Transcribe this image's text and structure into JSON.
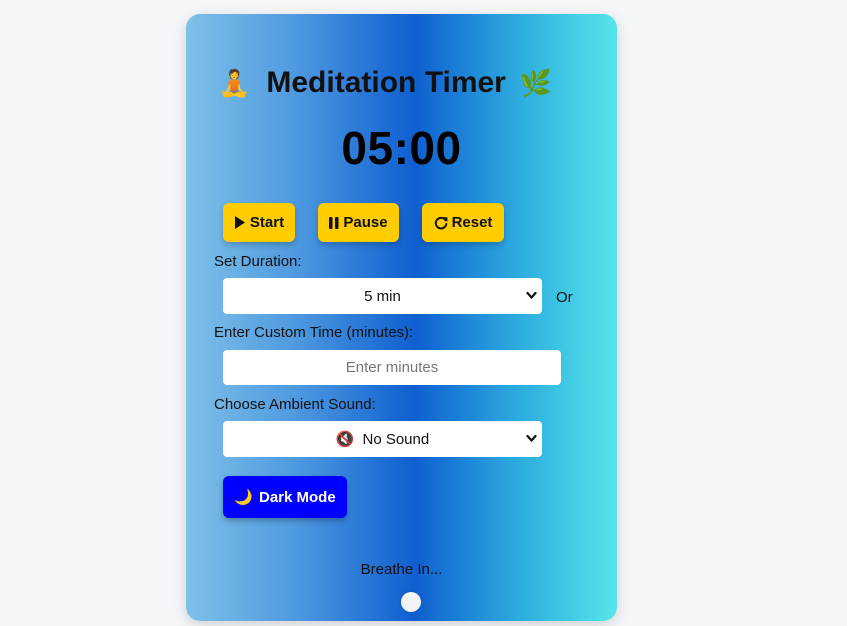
{
  "app": {
    "title": "Meditation Timer",
    "title_icon_left": "🧘",
    "title_icon_right": "🌿"
  },
  "timer": {
    "display": "05:00"
  },
  "controls": {
    "start_label": "Start",
    "pause_label": "Pause",
    "reset_label": "Reset"
  },
  "duration": {
    "label": "Set Duration:",
    "selected": "5 min",
    "or_text": "Or"
  },
  "custom_time": {
    "label": "Enter Custom Time (minutes):",
    "placeholder": "Enter minutes",
    "value": ""
  },
  "ambient_sound": {
    "label": "Choose Ambient Sound:",
    "selected_icon": "🔇",
    "selected": "No Sound"
  },
  "dark_mode": {
    "icon": "🌙",
    "label": "Dark Mode"
  },
  "breathing": {
    "text": "Breathe In..."
  },
  "colors": {
    "page_background": "#f5f6fa",
    "button_yellow": "#ffcc00",
    "dark_mode_button": "#0000ff",
    "gradient_left": "#7ec1e8",
    "gradient_middle": "#0f5fd0",
    "gradient_right": "#55e6e8"
  }
}
